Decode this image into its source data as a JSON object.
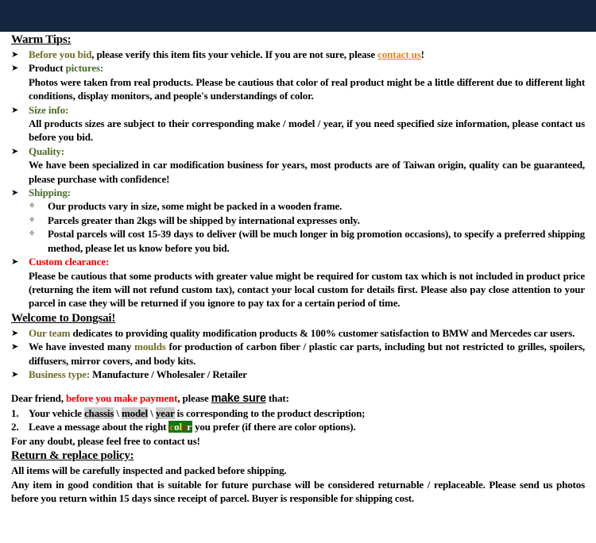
{
  "page": {
    "background_color": "#ffffff",
    "topbar_color": "#13253f",
    "accent_green": "#4a6b28",
    "accent_olive": "#6d6b26",
    "accent_red": "#ee0000",
    "accent_orange": "#e08214",
    "highlight_gray": "#c9c9c9",
    "highlight_green": "#117711"
  },
  "warm_tips": {
    "heading": "Warm Tips:",
    "bullet_glyph": "➤",
    "sub_bullet_glyph": "✧",
    "items": [
      {
        "lead": "Before you bid",
        "rest": ", please verify this item fits your vehicle. If you are not sure, please ",
        "link": "contact us",
        "tail": "!"
      },
      {
        "lead_black": "Product ",
        "lead_green": "pictures:",
        "body": "Photos were taken from real products. Please be cautious that color of real product might be a little different due to different light conditions, display monitors, and people's understandings of color."
      },
      {
        "lead_green": "Size info:",
        "body": "All products sizes are subject to their corresponding make / model / year, if you need specified size information, please contact us before you bid."
      },
      {
        "lead_green": "Quality:",
        "body": "We have been specialized in car modification business for years, most products are of Taiwan origin, quality can be guaranteed, please purchase with confidence!"
      },
      {
        "lead_green": "Shipping:",
        "sub_items": [
          "Our products vary in size, some might be packed in a wooden frame.",
          "Parcels greater than 2kgs will be shipped by international expresses only.",
          "Postal parcels will cost 15-39 days to deliver (will be much longer in big promotion occasions), to specify a preferred shipping method, please let us know before you bid."
        ]
      },
      {
        "lead_green": "Custom clearance:",
        "body": "Please be cautious that some products with greater value might be required for custom tax which is not included in product price (returning the item will not refund custom tax), contact your local custom for details first. Please also pay close attention to your parcel in case they will be returned if you ignore to pay tax for a certain period of time."
      }
    ]
  },
  "welcome": {
    "heading": "Welcome to Dongsai!",
    "item1_lead": "Our team",
    "item1_rest": " dedicates to providing quality modification products & 100% customer satisfaction to BMW and Mercedes car users.",
    "item2_pre": "We have invested many ",
    "item2_highlight": "moulds",
    "item2_rest": " for production of carbon fiber / plastic car parts, including but not restricted to grilles, spoilers, diffusers, mirror covers, and body kits.",
    "item3_lead": "Business type:",
    "item3_rest": " Manufacture / Wholesaler / Retailer"
  },
  "payment": {
    "intro_pre": "Dear friend, ",
    "intro_red": "before you make payment",
    "intro_mid": ", please ",
    "intro_strong": "make sure",
    "intro_post": " that:",
    "item1_num": "1.",
    "item1_pre": "Your vehicle ",
    "item1_hl1": "chassis",
    "item1_sep1": " \\ ",
    "item1_hl2": "model",
    "item1_sep2": " \\ ",
    "item1_hl3": "year",
    "item1_post": " is corresponding to the product description;",
    "item2_num": "2.",
    "item2_pre": "Leave a message about the right ",
    "item2_badge_letters": [
      "c",
      "o",
      "l",
      "o",
      "r"
    ],
    "item2_post": " you prefer (if there are color options).",
    "closing": "For any doubt, please feel free to contact us!"
  },
  "return_policy": {
    "heading": "Return & replace policy:",
    "line1": "All items will be carefully inspected and packed before shipping.",
    "line2": "Any item in good condition that is suitable for future purchase will be considered returnable / replaceable. Please send us photos before you return within 15 days since receipt of parcel. Buyer is responsible for shipping cost."
  }
}
